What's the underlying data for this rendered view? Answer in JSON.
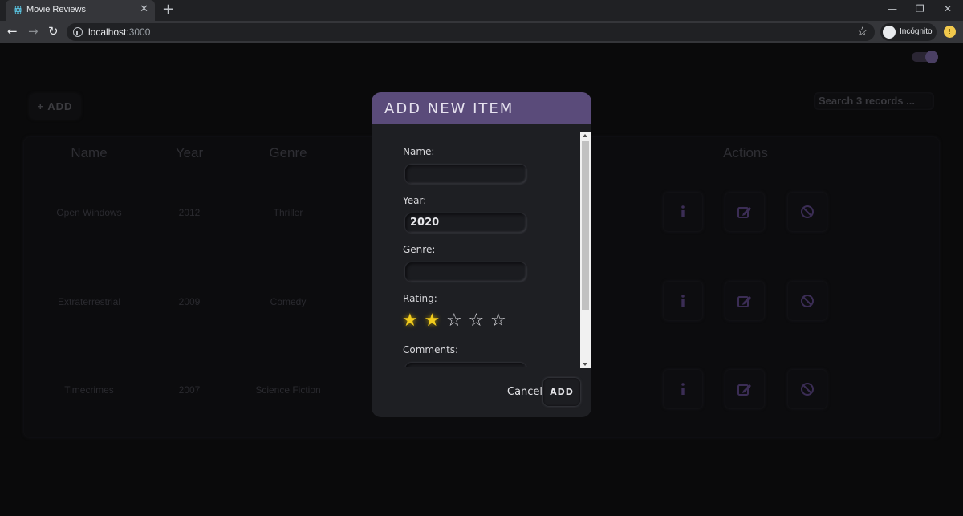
{
  "browser": {
    "tab_title": "Movie Reviews",
    "tab_close": "✕",
    "new_tab": "+",
    "url_host": "localhost",
    "url_port": ":3000",
    "incognito_label": "Incógnito"
  },
  "app": {
    "add_label": "+ ADD",
    "search_placeholder": "Search 3 records ...",
    "columns": [
      "Name",
      "Year",
      "Genre",
      "Actions"
    ],
    "rows": [
      {
        "name": "Open Windows",
        "year": "2012",
        "genre": "Thriller"
      },
      {
        "name": "Extraterrestrial",
        "year": "2009",
        "genre": "Comedy"
      },
      {
        "name": "Timecrimes",
        "year": "2007",
        "genre": "Science Fiction"
      }
    ]
  },
  "modal": {
    "title": "ADD NEW ITEM",
    "name_label": "Name:",
    "name_value": "",
    "year_label": "Year:",
    "year_value": "2020",
    "genre_label": "Genre:",
    "genre_value": "",
    "rating_label": "Rating:",
    "rating_value": 2,
    "rating_max": 5,
    "comments_label": "Comments:",
    "cancel_label": "Cancel",
    "add_label": "ADD"
  },
  "colors": {
    "accent": "#5a4b7a",
    "star_on": "#f2cc1d"
  }
}
